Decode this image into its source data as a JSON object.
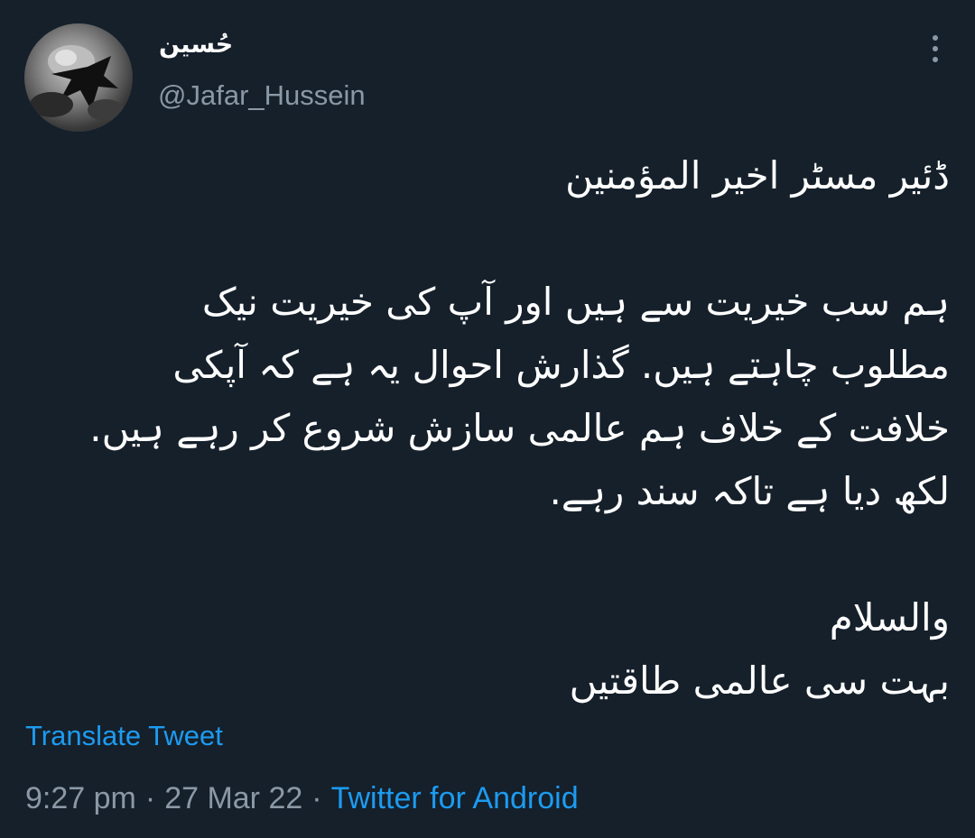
{
  "author": {
    "display_name": "حُسین",
    "handle": "@Jafar_Hussein"
  },
  "icons": {
    "avatar": "avatar-photo",
    "more": "more-vertical-icon"
  },
  "tweet": {
    "lines": [
      "ڈئیر مسٹر اخیر المؤمنین",
      "",
      "ہم سب خیریت سے ہیں اور آپ کی خیریت نیک",
      "مطلوب چاہتے ہیں. گذارش احوال یہ ہے کہ آپکی",
      "خلافت کے خلاف ہم عالمی سازش شروع کر رہے ہیں.",
      "لکھ دیا ہے تاکہ سند رہے.",
      "",
      "والسلام",
      "بہت سی عالمی طاقتیں"
    ]
  },
  "translate_label": "Translate Tweet",
  "meta": {
    "time": "9:27 pm",
    "separator": "·",
    "date": "27 Mar 22",
    "source": "Twitter for Android"
  },
  "colors": {
    "background": "#15202b",
    "text": "#ffffff",
    "secondary": "#8b98a5",
    "link": "#1d9bf0"
  }
}
